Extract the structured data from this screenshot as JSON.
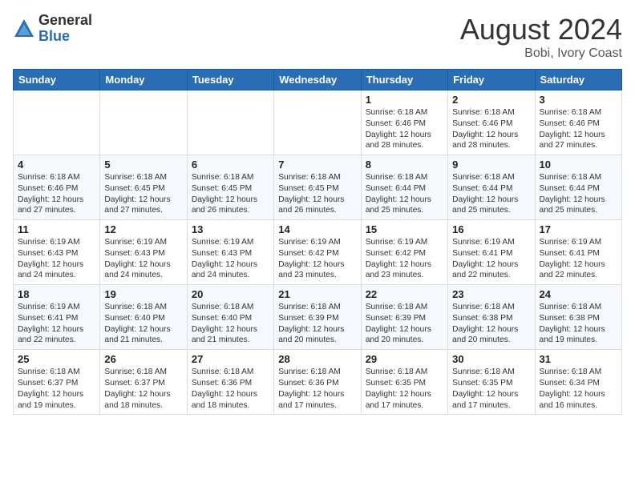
{
  "header": {
    "logo_general": "General",
    "logo_blue": "Blue",
    "month_title": "August 2024",
    "location": "Bobi, Ivory Coast"
  },
  "weekdays": [
    "Sunday",
    "Monday",
    "Tuesday",
    "Wednesday",
    "Thursday",
    "Friday",
    "Saturday"
  ],
  "weeks": [
    [
      {
        "day": "",
        "info": ""
      },
      {
        "day": "",
        "info": ""
      },
      {
        "day": "",
        "info": ""
      },
      {
        "day": "",
        "info": ""
      },
      {
        "day": "1",
        "info": "Sunrise: 6:18 AM\nSunset: 6:46 PM\nDaylight: 12 hours\nand 28 minutes."
      },
      {
        "day": "2",
        "info": "Sunrise: 6:18 AM\nSunset: 6:46 PM\nDaylight: 12 hours\nand 28 minutes."
      },
      {
        "day": "3",
        "info": "Sunrise: 6:18 AM\nSunset: 6:46 PM\nDaylight: 12 hours\nand 27 minutes."
      }
    ],
    [
      {
        "day": "4",
        "info": "Sunrise: 6:18 AM\nSunset: 6:46 PM\nDaylight: 12 hours\nand 27 minutes."
      },
      {
        "day": "5",
        "info": "Sunrise: 6:18 AM\nSunset: 6:45 PM\nDaylight: 12 hours\nand 27 minutes."
      },
      {
        "day": "6",
        "info": "Sunrise: 6:18 AM\nSunset: 6:45 PM\nDaylight: 12 hours\nand 26 minutes."
      },
      {
        "day": "7",
        "info": "Sunrise: 6:18 AM\nSunset: 6:45 PM\nDaylight: 12 hours\nand 26 minutes."
      },
      {
        "day": "8",
        "info": "Sunrise: 6:18 AM\nSunset: 6:44 PM\nDaylight: 12 hours\nand 25 minutes."
      },
      {
        "day": "9",
        "info": "Sunrise: 6:18 AM\nSunset: 6:44 PM\nDaylight: 12 hours\nand 25 minutes."
      },
      {
        "day": "10",
        "info": "Sunrise: 6:18 AM\nSunset: 6:44 PM\nDaylight: 12 hours\nand 25 minutes."
      }
    ],
    [
      {
        "day": "11",
        "info": "Sunrise: 6:19 AM\nSunset: 6:43 PM\nDaylight: 12 hours\nand 24 minutes."
      },
      {
        "day": "12",
        "info": "Sunrise: 6:19 AM\nSunset: 6:43 PM\nDaylight: 12 hours\nand 24 minutes."
      },
      {
        "day": "13",
        "info": "Sunrise: 6:19 AM\nSunset: 6:43 PM\nDaylight: 12 hours\nand 24 minutes."
      },
      {
        "day": "14",
        "info": "Sunrise: 6:19 AM\nSunset: 6:42 PM\nDaylight: 12 hours\nand 23 minutes."
      },
      {
        "day": "15",
        "info": "Sunrise: 6:19 AM\nSunset: 6:42 PM\nDaylight: 12 hours\nand 23 minutes."
      },
      {
        "day": "16",
        "info": "Sunrise: 6:19 AM\nSunset: 6:41 PM\nDaylight: 12 hours\nand 22 minutes."
      },
      {
        "day": "17",
        "info": "Sunrise: 6:19 AM\nSunset: 6:41 PM\nDaylight: 12 hours\nand 22 minutes."
      }
    ],
    [
      {
        "day": "18",
        "info": "Sunrise: 6:19 AM\nSunset: 6:41 PM\nDaylight: 12 hours\nand 22 minutes."
      },
      {
        "day": "19",
        "info": "Sunrise: 6:18 AM\nSunset: 6:40 PM\nDaylight: 12 hours\nand 21 minutes."
      },
      {
        "day": "20",
        "info": "Sunrise: 6:18 AM\nSunset: 6:40 PM\nDaylight: 12 hours\nand 21 minutes."
      },
      {
        "day": "21",
        "info": "Sunrise: 6:18 AM\nSunset: 6:39 PM\nDaylight: 12 hours\nand 20 minutes."
      },
      {
        "day": "22",
        "info": "Sunrise: 6:18 AM\nSunset: 6:39 PM\nDaylight: 12 hours\nand 20 minutes."
      },
      {
        "day": "23",
        "info": "Sunrise: 6:18 AM\nSunset: 6:38 PM\nDaylight: 12 hours\nand 20 minutes."
      },
      {
        "day": "24",
        "info": "Sunrise: 6:18 AM\nSunset: 6:38 PM\nDaylight: 12 hours\nand 19 minutes."
      }
    ],
    [
      {
        "day": "25",
        "info": "Sunrise: 6:18 AM\nSunset: 6:37 PM\nDaylight: 12 hours\nand 19 minutes."
      },
      {
        "day": "26",
        "info": "Sunrise: 6:18 AM\nSunset: 6:37 PM\nDaylight: 12 hours\nand 18 minutes."
      },
      {
        "day": "27",
        "info": "Sunrise: 6:18 AM\nSunset: 6:36 PM\nDaylight: 12 hours\nand 18 minutes."
      },
      {
        "day": "28",
        "info": "Sunrise: 6:18 AM\nSunset: 6:36 PM\nDaylight: 12 hours\nand 17 minutes."
      },
      {
        "day": "29",
        "info": "Sunrise: 6:18 AM\nSunset: 6:35 PM\nDaylight: 12 hours\nand 17 minutes."
      },
      {
        "day": "30",
        "info": "Sunrise: 6:18 AM\nSunset: 6:35 PM\nDaylight: 12 hours\nand 17 minutes."
      },
      {
        "day": "31",
        "info": "Sunrise: 6:18 AM\nSunset: 6:34 PM\nDaylight: 12 hours\nand 16 minutes."
      }
    ]
  ]
}
